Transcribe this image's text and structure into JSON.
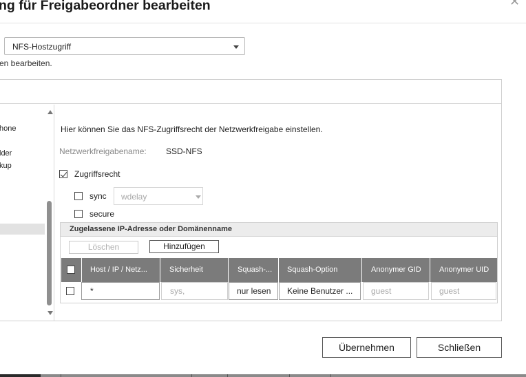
{
  "dialog": {
    "title": "ng für Freigabeordner bearbeiten",
    "close_icon": "close-icon"
  },
  "permission_type": {
    "selected": "NFS-Hostzugriff"
  },
  "intro_text": "en bearbeiten.",
  "left_list": {
    "items": [
      "hone",
      "lder",
      "kup"
    ]
  },
  "nfs": {
    "description": "Hier können Sie das NFS-Zugriffsrecht der Netzwerkfreigabe einstellen.",
    "share_name_label": "Netzwerkfreigabename:",
    "share_name_value": "SSD-NFS",
    "access_label": "Zugriffsrecht",
    "access_checked": true,
    "sync_label": "sync",
    "sync_checked": false,
    "sync_option": "wdelay",
    "secure_label": "secure",
    "secure_checked": false
  },
  "ip_section": {
    "title": "Zugelassene IP-Adresse oder Domänenname",
    "delete_label": "Löschen",
    "add_label": "Hinzufügen",
    "columns": [
      "Host / IP / Netz...",
      "Sicherheit",
      "Squash-...",
      "Squash-Option",
      "Anonymer GID",
      "Anonymer UID"
    ],
    "rows": [
      {
        "host": "*",
        "security": "sys,",
        "squash": "nur lesen",
        "squash_option": "Keine Benutzer ...",
        "gid": "guest",
        "uid": "guest"
      }
    ]
  },
  "footer": {
    "apply_label": "Übernehmen",
    "close_label": "Schließen"
  }
}
